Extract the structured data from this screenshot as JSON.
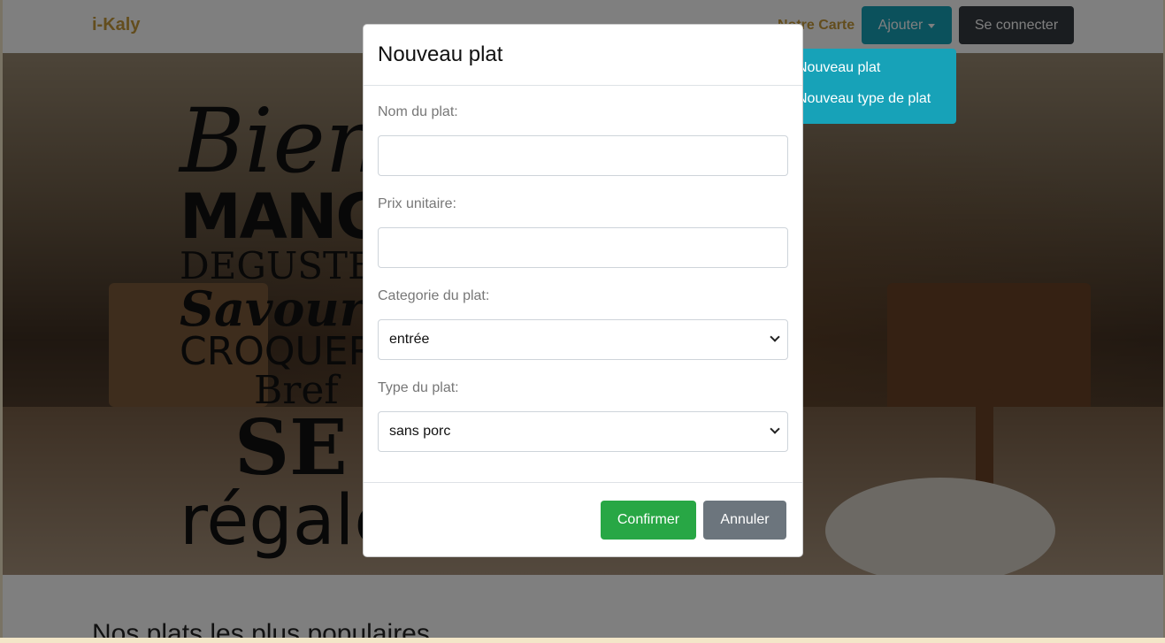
{
  "navbar": {
    "brand": "i-Kaly",
    "link": "Notre Carte",
    "ajouter_label": "Ajouter",
    "connect_label": "Se connecter",
    "dropdown": [
      "Nouveau plat",
      "Nouveau type de plat"
    ]
  },
  "hero": {
    "slogan": [
      "Bien",
      "MANGER",
      "DEGUSTER",
      "Savourer",
      "CROQUER",
      "Bref",
      "SE",
      "régaler"
    ]
  },
  "section": {
    "title": "Nos plats les plus populaires"
  },
  "modal": {
    "title": "Nouveau plat",
    "nom_label": "Nom du plat:",
    "nom_value": "",
    "prix_label": "Prix unitaire:",
    "prix_value": "",
    "categorie_label": "Categorie du plat:",
    "categorie_value": "entrée",
    "type_label": "Type du plat:",
    "type_value": "sans porc",
    "confirm_label": "Confirmer",
    "cancel_label": "Annuler"
  },
  "colors": {
    "brand": "#c79a3b",
    "info": "#17a2b8",
    "dark": "#343a40",
    "success": "#28a745",
    "secondary": "#6c757d"
  }
}
